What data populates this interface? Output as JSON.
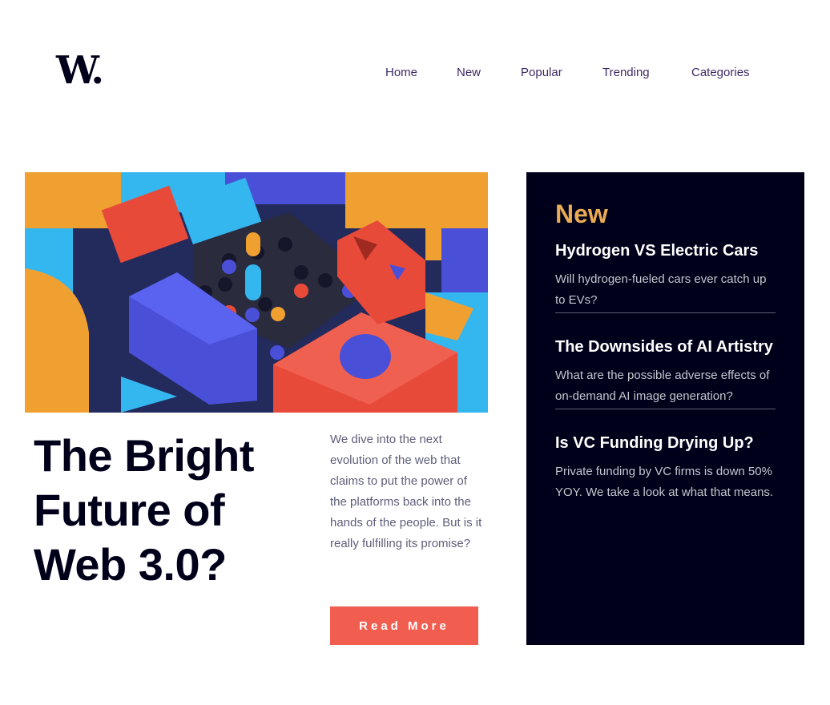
{
  "logo": {
    "text": "W."
  },
  "nav": {
    "items": [
      {
        "label": "Home"
      },
      {
        "label": "New"
      },
      {
        "label": "Popular"
      },
      {
        "label": "Trending"
      },
      {
        "label": "Categories"
      }
    ]
  },
  "hero": {
    "image_icon": "abstract-3d-blocks-image",
    "headline": "The Bright Future of Web 3.0?",
    "summary": "We dive into the next evolution of the web that claims to put the power of the platforms back into the hands of the people. But is it really fulfilling its promise?",
    "cta_label": "Read More"
  },
  "new_panel": {
    "heading": "New",
    "items": [
      {
        "title": "Hydrogen VS Electric Cars",
        "description": "Will hydrogen-fueled cars ever catch up to EVs?"
      },
      {
        "title": "The Downsides of AI Artistry",
        "description": "What are the possible adverse effects of on-demand AI image generation?"
      },
      {
        "title": "Is VC Funding Drying Up?",
        "description": "Private funding by VC firms is down 50% YOY. We take a look at what that means."
      }
    ]
  },
  "colors": {
    "very_dark_blue": "#00001a",
    "soft_orange": "#e9ab53",
    "soft_red": "#f15e50",
    "grayish_blue": "#5d5f79",
    "grayish_blue_light": "#c5c6ce",
    "nav_text": "#3d2a66"
  }
}
